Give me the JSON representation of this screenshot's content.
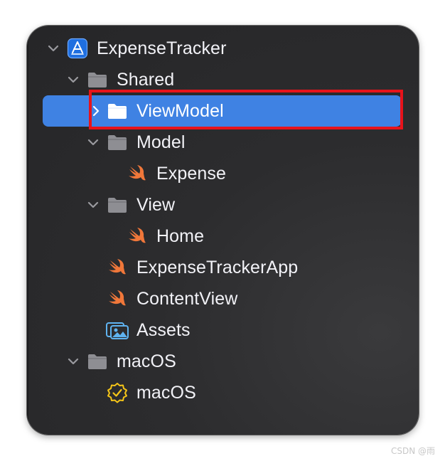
{
  "navigator": {
    "items": [
      {
        "label": "ExpenseTracker",
        "icon": "xcode-project-icon",
        "disclosure": "expanded",
        "level": 0
      },
      {
        "label": "Shared",
        "icon": "folder-icon",
        "disclosure": "expanded",
        "level": 1
      },
      {
        "label": "ViewModel",
        "icon": "folder-icon",
        "disclosure": "collapsed",
        "level": 2,
        "selected": true
      },
      {
        "label": "Model",
        "icon": "folder-icon",
        "disclosure": "expanded",
        "level": 2
      },
      {
        "label": "Expense",
        "icon": "swift-file-icon",
        "disclosure": "none",
        "level": 3
      },
      {
        "label": "View",
        "icon": "folder-icon",
        "disclosure": "expanded",
        "level": 2
      },
      {
        "label": "Home",
        "icon": "swift-file-icon",
        "disclosure": "none",
        "level": 3
      },
      {
        "label": "ExpenseTrackerApp",
        "icon": "swift-file-icon",
        "disclosure": "none",
        "level": 2
      },
      {
        "label": "ContentView",
        "icon": "swift-file-icon",
        "disclosure": "none",
        "level": 2
      },
      {
        "label": "Assets",
        "icon": "asset-catalog-icon",
        "disclosure": "none",
        "level": 2
      },
      {
        "label": "macOS",
        "icon": "folder-icon",
        "disclosure": "expanded",
        "level": 1
      },
      {
        "label": "macOS",
        "icon": "entitlements-icon",
        "disclosure": "none",
        "level": 2
      }
    ]
  },
  "colors": {
    "selection": "#3f82e3",
    "highlight_border": "#e8131a",
    "swift_orange": "#f0773a",
    "folder_gray": "#8e8e93"
  },
  "watermark": "CSDN @雨"
}
